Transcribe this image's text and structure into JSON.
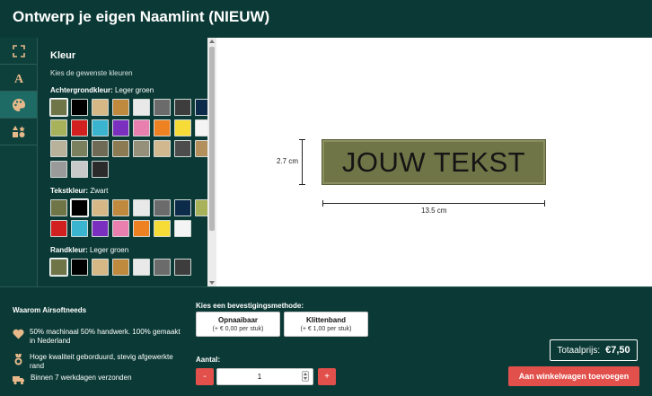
{
  "header": {
    "title": "Ontwerp je eigen Naamlint (NIEUW)"
  },
  "sidebar": {
    "icons": [
      "resize-icon",
      "text-icon",
      "palette-icon",
      "shapes-icon"
    ]
  },
  "panel": {
    "title": "Kleur",
    "subtitle": "Kies de gewenste kleuren",
    "background": {
      "label": "Achtergrondkleur:",
      "value": "Leger groen",
      "colors": [
        "#6f7547",
        "#000000",
        "#d6b886",
        "#c08a3e",
        "#e9e9e9",
        "#6b6b6b",
        "#3d3d3d",
        "#0c2a4a",
        "#a7b25a",
        "#d21f1f",
        "#3ab4cf",
        "#7a2fbf",
        "#e87fae",
        "#ee8121",
        "#f7dc38",
        "#f4f4f4",
        "#b9b29a",
        "#7a7f5e",
        "#6f6a55",
        "#8c7b52",
        "#95907a",
        "#d2b88e",
        "#4d4d4d",
        "#b38f5c",
        "#9a9a9a",
        "#c9c9c9",
        "#2b2b2b"
      ]
    },
    "text": {
      "label": "Tekstkleur:",
      "value": "Zwart",
      "colors": [
        "#6f7547",
        "#000000",
        "#d6b886",
        "#c08a3e",
        "#e9e9e9",
        "#6b6b6b",
        "#0c2a4a",
        "#a7b25a",
        "#d21f1f",
        "#3ab4cf",
        "#7a2fbf",
        "#e87fae",
        "#ee8121",
        "#f7dc38",
        "#f4f4f4"
      ]
    },
    "border": {
      "label": "Randkleur:",
      "value": "Leger groen",
      "colors": [
        "#6f7547",
        "#000000",
        "#d6b886",
        "#c08a3e",
        "#e9e9e9",
        "#6b6b6b",
        "#3d3d3d"
      ]
    }
  },
  "preview": {
    "patch_text": "JOUW TEKST",
    "height_label": "2.7 cm",
    "width_label": "13.5 cm"
  },
  "why": {
    "title": "Waarom Airsoftneeds",
    "items": [
      {
        "icon": "heart-icon",
        "text": "50% machinaal 50% handwerk. 100% gemaakt in Nederland"
      },
      {
        "icon": "medal-icon",
        "text": "Hoge kwaliteit geborduurd, stevig afgewerkte rand"
      },
      {
        "icon": "truck-icon",
        "text": "Binnen 7 werkdagen verzonden"
      }
    ]
  },
  "attachment": {
    "title": "Kies een bevestigingsmethode:",
    "options": [
      {
        "name": "Opnaaibaar",
        "price": "(+ € 0,00 per stuk)"
      },
      {
        "name": "Klittenband",
        "price": "(+ € 1,00 per stuk)"
      }
    ]
  },
  "quantity": {
    "label": "Aantal:",
    "value": "1",
    "minus": "-",
    "plus": "+"
  },
  "total": {
    "label": "Totaalprijs:",
    "amount": "€7,50"
  },
  "cart": {
    "label": "Aan winkelwagen toevoegen"
  }
}
